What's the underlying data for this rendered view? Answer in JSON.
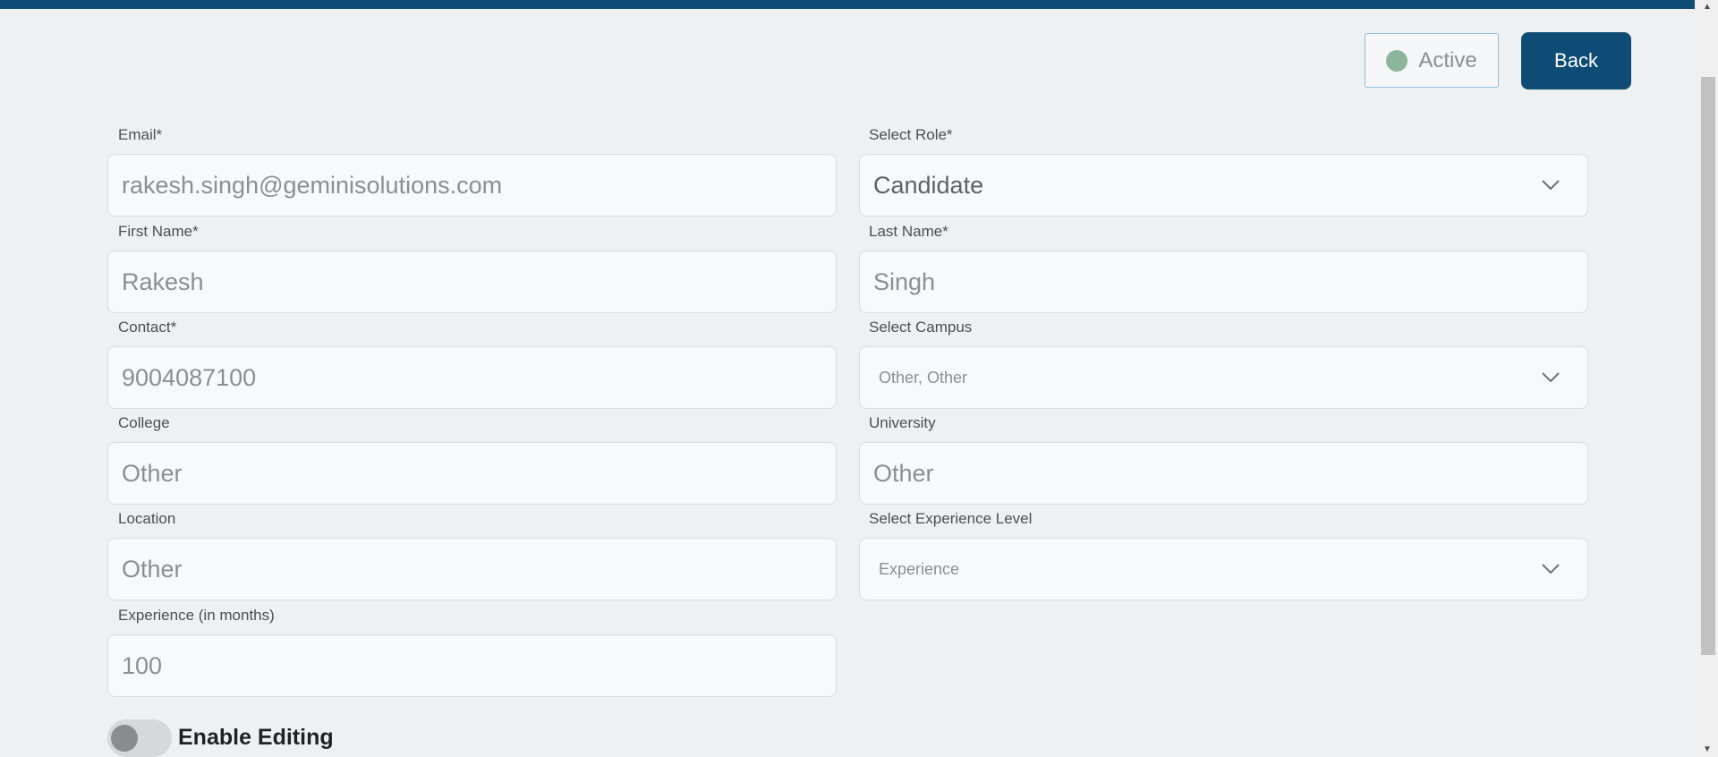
{
  "header": {
    "status_label": "Active",
    "back_label": "Back"
  },
  "form": {
    "email": {
      "label": "Email*",
      "value": "rakesh.singh@geminisolutions.com"
    },
    "role": {
      "label": "Select Role*",
      "value": "Candidate"
    },
    "first_name": {
      "label": "First Name*",
      "value": "Rakesh"
    },
    "last_name": {
      "label": "Last Name*",
      "value": "Singh"
    },
    "contact": {
      "label": "Contact*",
      "value": "9004087100"
    },
    "campus": {
      "label": "Select Campus",
      "value": "Other, Other"
    },
    "college": {
      "label": "College",
      "value": "Other"
    },
    "university": {
      "label": "University",
      "value": "Other"
    },
    "location": {
      "label": "Location",
      "value": "Other"
    },
    "experience_level": {
      "label": "Select Experience Level",
      "value": "Experience"
    },
    "experience_months": {
      "label": "Experience (in months)",
      "value": "100"
    }
  },
  "editing": {
    "label": "Enable Editing",
    "enabled": false
  },
  "colors": {
    "brand": "#0f4c75",
    "status_dot": "#8db59b"
  }
}
